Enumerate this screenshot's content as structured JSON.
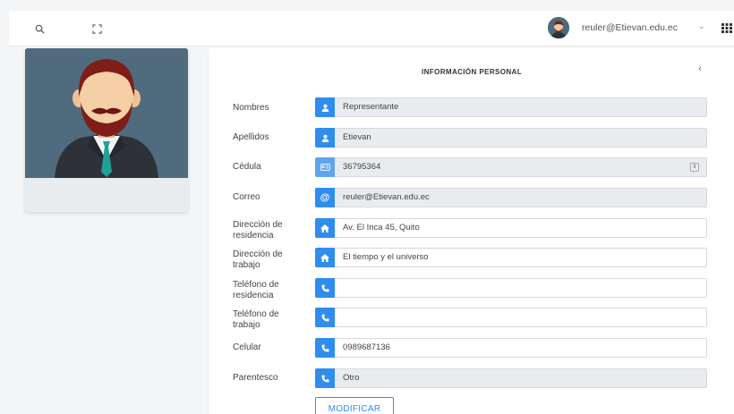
{
  "header": {
    "user_email": "reuler@Etievan.edu.ec",
    "icons": [
      "search-icon",
      "fullscreen-icon",
      "chevron-down-icon",
      "grid-icon"
    ]
  },
  "panel": {
    "title": "INFORMACIÓN PERSONAL",
    "collapse_symbol": "‹"
  },
  "form": {
    "nombres": {
      "label": "Nombres",
      "value": "Representante",
      "icon": "user-icon"
    },
    "apellidos": {
      "label": "Apellidos",
      "value": "Etievan",
      "icon": "user-icon"
    },
    "cedula": {
      "label": "Cédula",
      "value": "36795364",
      "icon": "id-card-icon"
    },
    "correo": {
      "label": "Correo",
      "value": "reuler@Etievan.edu.ec",
      "icon": "at-icon"
    },
    "direccion_residencia": {
      "label_1": "Dirección de",
      "label_2": "residencia",
      "value": "Av. El Inca 45, Quito",
      "icon": "home-icon"
    },
    "direccion_trabajo": {
      "label_1": "Dirección de",
      "label_2": "trabajo",
      "value": "El tiempo y el universo",
      "icon": "home-icon"
    },
    "telefono_residencia": {
      "label_1": "Teléfono de",
      "label_2": "residencia",
      "value": "",
      "icon": "phone-icon"
    },
    "telefono_trabajo": {
      "label_1": "Teléfono de",
      "label_2": "trabajo",
      "value": "",
      "icon": "phone-icon"
    },
    "celular": {
      "label": "Celular",
      "value": "0989687136",
      "icon": "phone-icon"
    },
    "parentesco": {
      "label": "Parentesco",
      "value": "Otro",
      "icon": "phone-icon"
    }
  },
  "actions": {
    "modify_label": "MODIFICAR"
  },
  "colors": {
    "primary": "#2f8dee",
    "avatar_bg": "#4f6b7d",
    "readonly_bg": "#e9ecef"
  }
}
